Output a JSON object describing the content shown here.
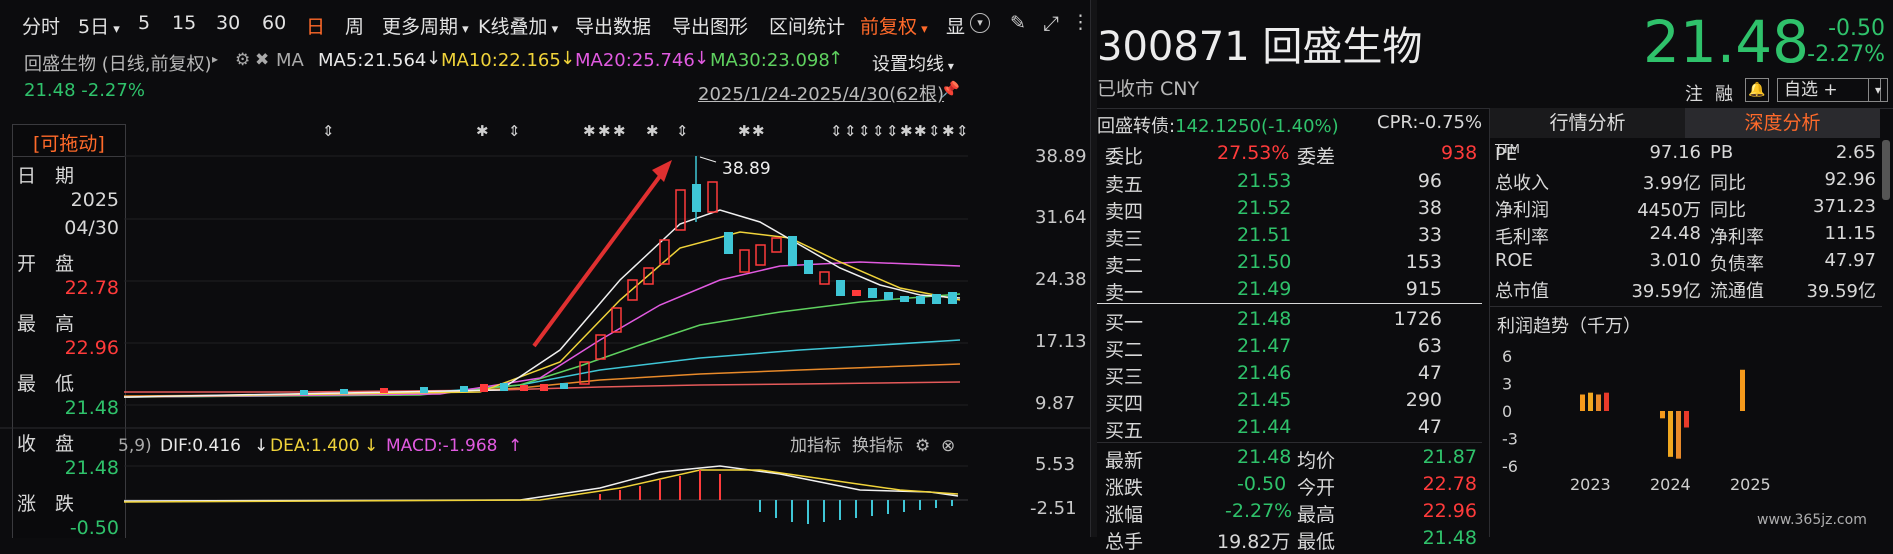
{
  "toolbar": {
    "items": [
      "分时",
      "5日",
      "5",
      "15",
      "30",
      "60",
      "日",
      "周",
      "更多周期",
      "K线叠加",
      "导出数据",
      "导出图形",
      "区间统计",
      "前复权",
      "显"
    ],
    "active_index": 6,
    "orange_index": 13
  },
  "chart_header": {
    "stock_label": "回盛生物 (日线,前复权)",
    "ma_label": "MA",
    "ma5": "MA5:21.564",
    "ma10": "MA10:22.165",
    "ma20": "MA20:25.746",
    "ma30": "MA30:23.098",
    "settings": "设置均线",
    "price_change": "21.48 -2.27%",
    "range": "2025/1/24-2025/4/30(62根)"
  },
  "sidebar": {
    "title": "[可拖动]",
    "date_label": "日　期",
    "year": "2025",
    "date": "04/30",
    "open_label": "开　盘",
    "open": "22.78",
    "high_label": "最　高",
    "high": "22.96",
    "low_label": "最　低",
    "low": "21.48",
    "close_label": "收　盘",
    "close": "21.48",
    "change_label": "涨　跌",
    "change": "-0.50"
  },
  "chart_axis": {
    "price_ticks": [
      "38.89",
      "31.64",
      "24.38",
      "17.13",
      "9.87"
    ],
    "macd_ticks": [
      "5.53",
      "-2.51"
    ],
    "peak_label": "38.89"
  },
  "macd": {
    "params": "5,9)",
    "dif": "DIF:0.416",
    "dea": "DEA:1.400",
    "macd": "MACD:-1.968",
    "add_indicator": "加指标",
    "switch_indicator": "换指标"
  },
  "quote": {
    "code": "300871",
    "name": "回盛生物",
    "status": "已收市 CNY",
    "price": "21.48",
    "change": "-0.50",
    "change_pct": "-2.27%",
    "watch": "注",
    "margin": "融",
    "self_select": "自选 +"
  },
  "convertible": {
    "label": "回盛转债:",
    "value": "142.1250(-1.40%)",
    "cpr": "CPR:-0.75%"
  },
  "order_book": {
    "webi_label": "委比",
    "webi": "27.53%",
    "weicha_label": "委差",
    "weicha": "938",
    "asks": [
      {
        "label": "卖五",
        "price": "21.53",
        "vol": "96"
      },
      {
        "label": "卖四",
        "price": "21.52",
        "vol": "38"
      },
      {
        "label": "卖三",
        "price": "21.51",
        "vol": "33"
      },
      {
        "label": "卖二",
        "price": "21.50",
        "vol": "153"
      },
      {
        "label": "卖一",
        "price": "21.49",
        "vol": "915"
      }
    ],
    "bids": [
      {
        "label": "买一",
        "price": "21.48",
        "vol": "1726"
      },
      {
        "label": "买二",
        "price": "21.47",
        "vol": "63"
      },
      {
        "label": "买三",
        "price": "21.46",
        "vol": "47"
      },
      {
        "label": "买四",
        "price": "21.45",
        "vol": "290"
      },
      {
        "label": "买五",
        "price": "21.44",
        "vol": "47"
      }
    ],
    "stats": [
      {
        "l1": "最新",
        "v1": "21.48",
        "l2": "均价",
        "v2": "21.87"
      },
      {
        "l1": "涨跌",
        "v1": "-0.50",
        "l2": "今开",
        "v2": "22.78"
      },
      {
        "l1": "涨幅",
        "v1": "-2.27%",
        "l2": "最高",
        "v2": "22.96"
      },
      {
        "l1": "总手",
        "v1": "19.82万",
        "l2": "最低",
        "v2": "21.48"
      }
    ]
  },
  "analysis": {
    "tab1": "行情分析",
    "tab2": "深度分析",
    "rows": [
      {
        "l1": "PE",
        "sup": "TTM",
        "v1": "97.16",
        "l2": "PB",
        "v2": "2.65"
      },
      {
        "l1": "总收入",
        "v1": "3.99亿",
        "l2": "同比",
        "v2": "92.96"
      },
      {
        "l1": "净利润",
        "v1": "4450万",
        "l2": "同比",
        "v2": "371.23"
      },
      {
        "l1": "毛利率",
        "v1": "24.48",
        "l2": "净利率",
        "v2": "11.15"
      },
      {
        "l1": "ROE",
        "v1": "3.010",
        "l2": "负债率",
        "v2": "47.97"
      },
      {
        "l1": "总市值",
        "v1": "39.59亿",
        "l2": "流通值",
        "v2": "39.59亿"
      }
    ],
    "profit_title": "利润趋势（千万）"
  },
  "chart_data": {
    "type": "bar",
    "title": "利润趋势（千万）",
    "categories": [
      "2023",
      "2024",
      "2025"
    ],
    "yticks": [
      "6",
      "3",
      "0",
      "-3",
      "-6"
    ],
    "ylim": [
      -6,
      6
    ],
    "series": [
      {
        "values_2023": [
          1.8,
          2.0,
          1.8,
          2.0
        ]
      },
      {
        "values_2024": [
          -0.8,
          -5.0,
          -5.2,
          -1.8
        ]
      },
      {
        "values_2025": [
          4.5
        ]
      }
    ],
    "quarters": [
      {
        "year": "2023",
        "values": [
          1.8,
          2.0,
          1.8,
          2.0
        ]
      },
      {
        "year": "2024",
        "values": [
          -0.8,
          -5.0,
          -5.2,
          -1.8
        ]
      },
      {
        "year": "2025",
        "values": [
          4.5
        ]
      }
    ]
  },
  "watermark": "www.365jz.com"
}
